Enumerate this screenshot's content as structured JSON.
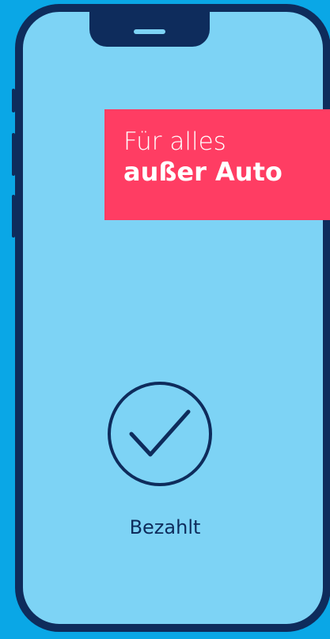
{
  "banner": {
    "line1": "Für alles",
    "line2": "außer Auto"
  },
  "status": {
    "icon": "checkmark-circle-icon",
    "label": "Bezahlt"
  },
  "colors": {
    "background": "#0aa7e6",
    "screen": "#7dd3f5",
    "frame": "#0e2c5c",
    "banner": "#ff3d63",
    "banner_text": "#ffffff"
  }
}
